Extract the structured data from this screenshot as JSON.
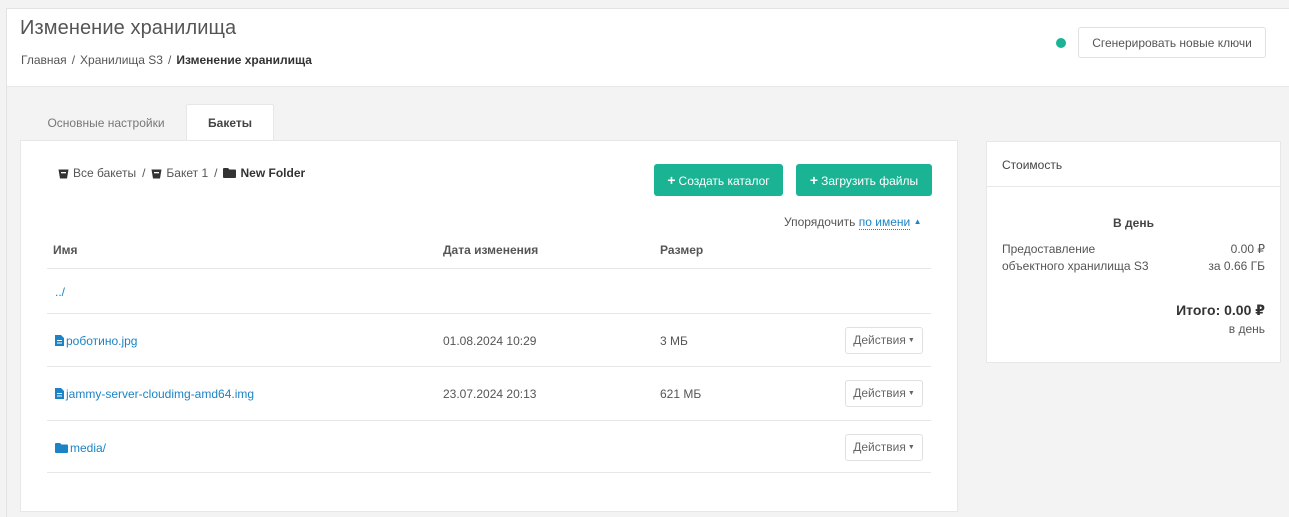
{
  "header": {
    "title": "Изменение хранилища",
    "breadcrumb": [
      "Главная",
      "Хранилища S3",
      "Изменение хранилища"
    ],
    "generate_keys_label": "Сгенерировать новые ключи",
    "status_color": "#1ab394"
  },
  "tabs": [
    {
      "label": "Основные настройки",
      "active": false
    },
    {
      "label": "Бакеты",
      "active": true
    }
  ],
  "path": {
    "all_buckets": "Все бакеты",
    "bucket": "Бакет 1",
    "folder": "New Folder"
  },
  "actions": {
    "create_folder": "Создать каталог",
    "upload_files": "Загрузить файлы"
  },
  "sort": {
    "label": "Упорядочить",
    "by": "по имени"
  },
  "table": {
    "columns": [
      "Имя",
      "Дата изменения",
      "Размер"
    ],
    "parent_link": "../",
    "rows": [
      {
        "icon": "file-icon",
        "name": "роботино.jpg",
        "date": "01.08.2024 10:29",
        "size": "3 МБ",
        "action": "Действия"
      },
      {
        "icon": "file-icon",
        "name": "jammy-server-cloudimg-amd64.img",
        "date": "23.07.2024 20:13",
        "size": "621 МБ",
        "action": "Действия"
      },
      {
        "icon": "folder-icon",
        "name": "media/",
        "date": "",
        "size": "",
        "action": "Действия"
      }
    ]
  },
  "cost": {
    "title": "Стоимость",
    "period_label": "В день",
    "item_name": "Предоставление объектного хранилища S3",
    "item_price": "0.00 ₽",
    "item_volume": "за 0.66 ГБ",
    "total": "Итого: 0.00 ₽",
    "total_period": "в день"
  },
  "colors": {
    "accent": "#1ab394",
    "link": "#1c84c6"
  }
}
